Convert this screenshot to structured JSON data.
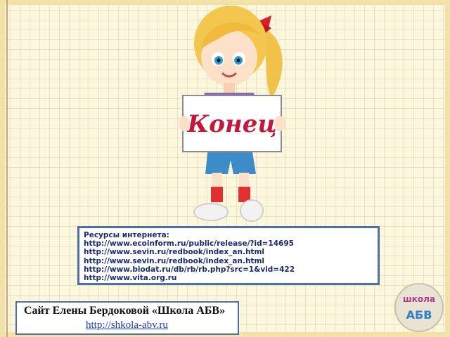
{
  "sign": {
    "text": "Конец"
  },
  "resources": {
    "title": "Ресурсы интернета:",
    "links": [
      "http://www.ecoinform.ru/public/release/?id=14695",
      "http://www.sevin.ru/redbook/index_an.html",
      "http://www.sevin.ru/redbook/index_an.html",
      "http://www.biodat.ru/db/rb/rb.php?src=1&vid=422",
      "http://www.vita.org.ru"
    ]
  },
  "credit": {
    "line1": "Сайт  Елены Бердоковой  «Школа АБВ»",
    "url": "http://shkola-abv.ru"
  },
  "logo": {
    "top": "школа",
    "bottom": "АБВ"
  },
  "colors": {
    "background": "#fbf6dc",
    "frame": "#f2e2a8",
    "box_border": "#4f6ea8",
    "sign_text": "#c2183a"
  }
}
